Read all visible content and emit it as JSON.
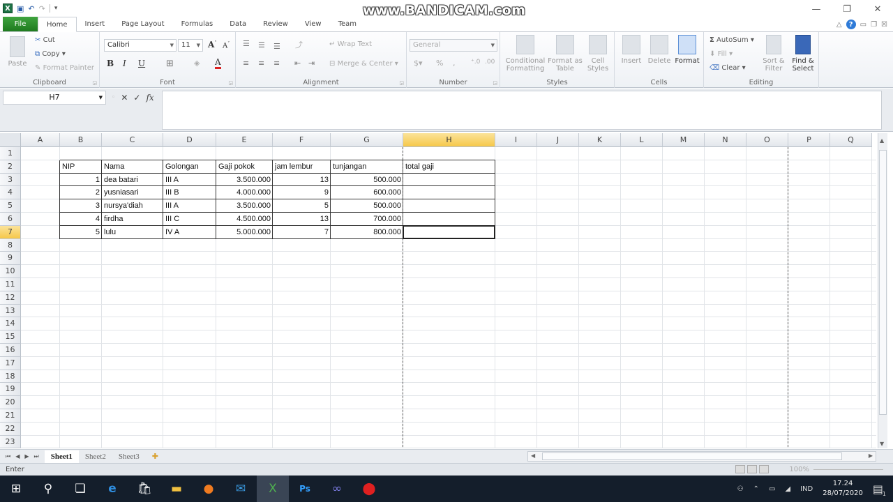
{
  "window": {
    "watermark": "www.BANDICAM.com",
    "controls": {
      "minimize": "—",
      "restore": "❐",
      "close": "✕"
    }
  },
  "tabs": [
    {
      "label": "File"
    },
    {
      "label": "Home"
    },
    {
      "label": "Insert"
    },
    {
      "label": "Page Layout"
    },
    {
      "label": "Formulas"
    },
    {
      "label": "Data"
    },
    {
      "label": "Review"
    },
    {
      "label": "View"
    },
    {
      "label": "Team"
    }
  ],
  "ribbon": {
    "clipboard": {
      "label": "Clipboard",
      "paste": "Paste",
      "cut": "Cut",
      "copy": "Copy",
      "format_painter": "Format Painter"
    },
    "font": {
      "label": "Font",
      "name": "Calibri",
      "size": "11",
      "bold": "B",
      "italic": "I",
      "underline": "U"
    },
    "alignment": {
      "label": "Alignment",
      "wrap": "Wrap Text",
      "merge": "Merge & Center"
    },
    "number": {
      "label": "Number",
      "format": "General",
      "percent": "%"
    },
    "styles": {
      "label": "Styles",
      "conditional": "Conditional Formatting",
      "format_table": "Format as Table",
      "cell_styles": "Cell Styles"
    },
    "cells": {
      "label": "Cells",
      "insert": "Insert",
      "delete": "Delete",
      "format": "Format"
    },
    "editing": {
      "label": "Editing",
      "autosum": "AutoSum",
      "fill": "Fill",
      "clear": "Clear",
      "sort": "Sort & Filter",
      "find": "Find & Select"
    }
  },
  "formula_bar": {
    "name_box": "H7",
    "cancel": "✕",
    "enter": "✓",
    "fx": "fx",
    "value": ""
  },
  "columns": [
    "A",
    "B",
    "C",
    "D",
    "E",
    "F",
    "G",
    "H",
    "I",
    "J",
    "K",
    "L",
    "M",
    "N",
    "O",
    "P",
    "Q"
  ],
  "selected_column": "H",
  "rows": [
    "1",
    "2",
    "3",
    "4",
    "5",
    "6",
    "7",
    "8",
    "9",
    "10",
    "11",
    "12",
    "13",
    "14",
    "15",
    "16",
    "17",
    "18",
    "19",
    "20",
    "21",
    "22",
    "23"
  ],
  "selected_row": "7",
  "table": {
    "headers": [
      "NIP",
      "Nama",
      "Golongan",
      "Gaji pokok",
      "jam lembur",
      "tunjangan",
      "total gaji"
    ],
    "rows": [
      [
        "1",
        "dea batari",
        "III A",
        "3.500.000",
        "13",
        "500.000",
        ""
      ],
      [
        "2",
        "yusniasari",
        "III B",
        "4.000.000",
        "9",
        "600.000",
        ""
      ],
      [
        "3",
        "nursya'diah",
        "III A",
        "3.500.000",
        "5",
        "500.000",
        ""
      ],
      [
        "4",
        "firdha",
        "III C",
        "4.500.000",
        "13",
        "700.000",
        ""
      ],
      [
        "5",
        "lulu",
        "IV A",
        "5.000.000",
        "7",
        "800.000",
        ""
      ]
    ]
  },
  "sheets": [
    {
      "label": "Sheet1",
      "active": true
    },
    {
      "label": "Sheet2",
      "active": false
    },
    {
      "label": "Sheet3",
      "active": false
    }
  ],
  "status": {
    "mode": "Enter",
    "zoom": "100%"
  },
  "taskbar": {
    "apps": [
      "start",
      "search",
      "task-view",
      "edge",
      "store",
      "file-explorer",
      "firefox",
      "mail",
      "excel",
      "photoshop",
      "app",
      "bandicam"
    ],
    "language": "IND",
    "time": "17.24",
    "date": "28/07/2020",
    "notifications": "1"
  }
}
